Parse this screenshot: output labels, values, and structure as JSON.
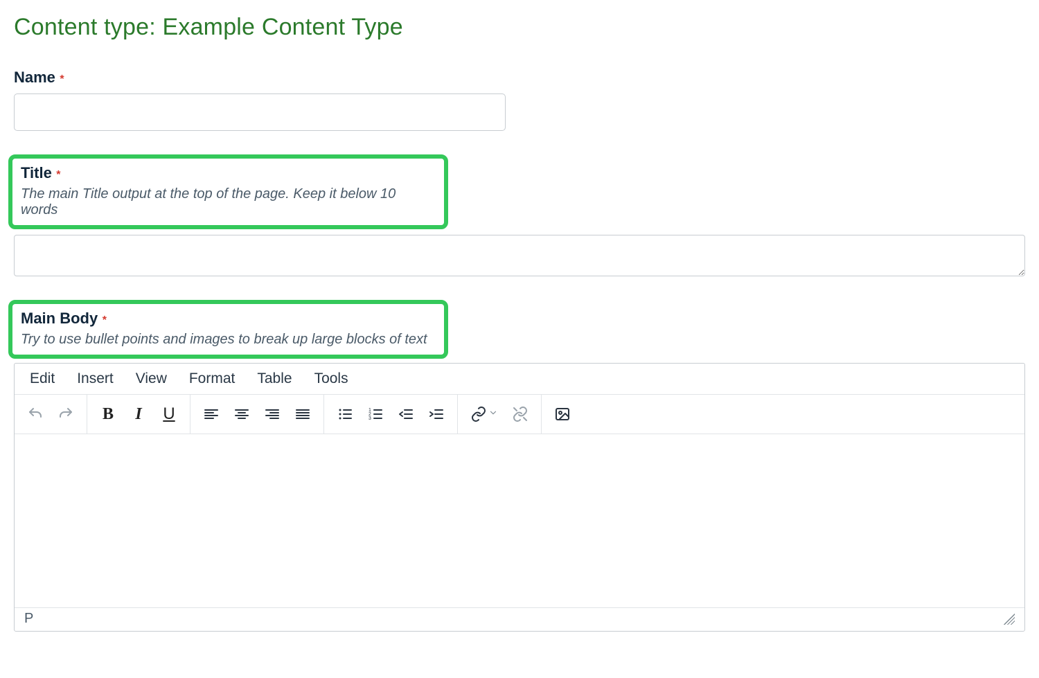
{
  "page": {
    "heading": "Content type: Example Content Type"
  },
  "fields": {
    "name": {
      "label": "Name",
      "required_marker": "*",
      "value": ""
    },
    "title": {
      "label": "Title",
      "required_marker": "*",
      "help": "The main Title output at the top of the page. Keep it below 10 words",
      "value": ""
    },
    "body": {
      "label": "Main Body",
      "required_marker": "*",
      "help": "Try to use bullet points and images to break up large blocks of text",
      "value": ""
    }
  },
  "editor": {
    "menus": [
      "Edit",
      "Insert",
      "View",
      "Format",
      "Table",
      "Tools"
    ],
    "status_path": "P"
  },
  "icons": {
    "undo": "undo-icon",
    "redo": "redo-icon",
    "bold": "B",
    "italic": "I",
    "underline": "U",
    "align_left": "align-left-icon",
    "align_center": "align-center-icon",
    "align_right": "align-right-icon",
    "align_justify": "align-justify-icon",
    "list_bullet": "list-bullet-icon",
    "list_number": "list-number-icon",
    "outdent": "outdent-icon",
    "indent": "indent-icon",
    "link": "link-icon",
    "unlink": "unlink-icon",
    "image": "image-icon"
  },
  "colors": {
    "heading_green": "#2b7a2b",
    "highlight_green": "#34c85a",
    "required_red": "#d43a2f",
    "border_gray": "#c7ccd1",
    "text_dark": "#11263a",
    "muted_icon": "#9aa3ab"
  }
}
